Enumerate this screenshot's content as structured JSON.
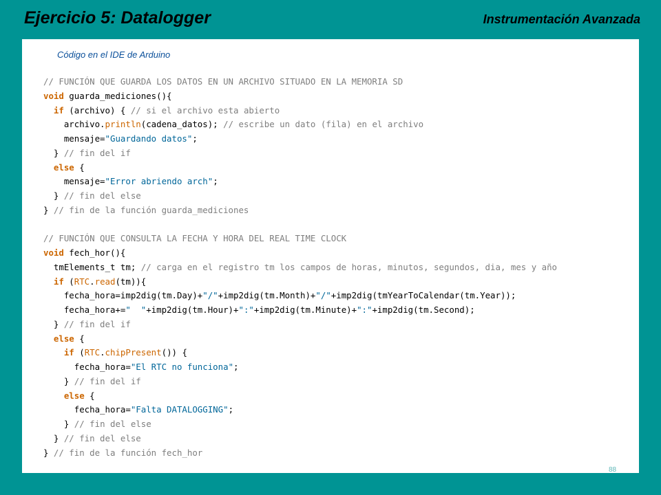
{
  "slide": {
    "title": "Ejercicio 5: Datalogger",
    "course": "Instrumentación Avanzada",
    "caption": "Código  en el IDE de Arduino",
    "page_number": "88"
  },
  "colors": {
    "background": "#009494",
    "keyword": "#cc6600",
    "comment": "#7e7e7e",
    "string": "#006699",
    "caption": "#0a4f9a"
  },
  "code": {
    "lines": [
      [
        {
          "t": "// FUNCIÓN QUE GUARDA LOS DATOS EN UN ARCHIVO SITUADO EN LA MEMORIA SD",
          "c": "cm"
        }
      ],
      [
        {
          "t": "void",
          "c": "tp"
        },
        {
          "t": " guarda_mediciones(){",
          "c": "id"
        }
      ],
      [
        {
          "t": "  ",
          "c": "id"
        },
        {
          "t": "if",
          "c": "kw"
        },
        {
          "t": " (archivo) { ",
          "c": "id"
        },
        {
          "t": "// si el archivo esta abierto",
          "c": "cm"
        }
      ],
      [
        {
          "t": "    archivo.",
          "c": "id"
        },
        {
          "t": "println",
          "c": "fn"
        },
        {
          "t": "(cadena_datos); ",
          "c": "id"
        },
        {
          "t": "// escribe un dato (fila) en el archivo",
          "c": "cm"
        }
      ],
      [
        {
          "t": "    mensaje=",
          "c": "id"
        },
        {
          "t": "\"Guardando datos\"",
          "c": "st"
        },
        {
          "t": ";",
          "c": "id"
        }
      ],
      [
        {
          "t": "  } ",
          "c": "id"
        },
        {
          "t": "// fin del if",
          "c": "cm"
        }
      ],
      [
        {
          "t": "  ",
          "c": "id"
        },
        {
          "t": "else",
          "c": "kw"
        },
        {
          "t": " {",
          "c": "id"
        }
      ],
      [
        {
          "t": "    mensaje=",
          "c": "id"
        },
        {
          "t": "\"Error abriendo arch\"",
          "c": "st"
        },
        {
          "t": ";",
          "c": "id"
        }
      ],
      [
        {
          "t": "  } ",
          "c": "id"
        },
        {
          "t": "// fin del else",
          "c": "cm"
        }
      ],
      [
        {
          "t": "} ",
          "c": "id"
        },
        {
          "t": "// fin de la función guarda_mediciones",
          "c": "cm"
        }
      ],
      [],
      [
        {
          "t": "// FUNCIÓN QUE CONSULTA LA FECHA Y HORA DEL REAL TIME CLOCK",
          "c": "cm"
        }
      ],
      [
        {
          "t": "void",
          "c": "tp"
        },
        {
          "t": " fech_hor(){",
          "c": "id"
        }
      ],
      [
        {
          "t": "  tmElements_t tm; ",
          "c": "id"
        },
        {
          "t": "// carga en el registro tm los campos de horas, minutos, segundos, dia, mes y año",
          "c": "cm"
        }
      ],
      [
        {
          "t": "  ",
          "c": "id"
        },
        {
          "t": "if",
          "c": "kw"
        },
        {
          "t": " (",
          "c": "id"
        },
        {
          "t": "RTC",
          "c": "fn"
        },
        {
          "t": ".",
          "c": "id"
        },
        {
          "t": "read",
          "c": "fn"
        },
        {
          "t": "(tm)){",
          "c": "id"
        }
      ],
      [
        {
          "t": "    fecha_hora=imp2dig(tm.Day)+",
          "c": "id"
        },
        {
          "t": "\"/\"",
          "c": "st"
        },
        {
          "t": "+imp2dig(tm.Month)+",
          "c": "id"
        },
        {
          "t": "\"/\"",
          "c": "st"
        },
        {
          "t": "+imp2dig(tmYearToCalendar(tm.Year));",
          "c": "id"
        }
      ],
      [
        {
          "t": "    fecha_hora+=",
          "c": "id"
        },
        {
          "t": "\"  \"",
          "c": "st"
        },
        {
          "t": "+imp2dig(tm.Hour)+",
          "c": "id"
        },
        {
          "t": "\":\"",
          "c": "st"
        },
        {
          "t": "+imp2dig(tm.Minute)+",
          "c": "id"
        },
        {
          "t": "\":\"",
          "c": "st"
        },
        {
          "t": "+imp2dig(tm.Second);",
          "c": "id"
        }
      ],
      [
        {
          "t": "  } ",
          "c": "id"
        },
        {
          "t": "// fin del if",
          "c": "cm"
        }
      ],
      [
        {
          "t": "  ",
          "c": "id"
        },
        {
          "t": "else",
          "c": "kw"
        },
        {
          "t": " {",
          "c": "id"
        }
      ],
      [
        {
          "t": "    ",
          "c": "id"
        },
        {
          "t": "if",
          "c": "kw"
        },
        {
          "t": " (",
          "c": "id"
        },
        {
          "t": "RTC",
          "c": "fn"
        },
        {
          "t": ".",
          "c": "id"
        },
        {
          "t": "chipPresent",
          "c": "fn"
        },
        {
          "t": "()) {",
          "c": "id"
        }
      ],
      [
        {
          "t": "      fecha_hora=",
          "c": "id"
        },
        {
          "t": "\"El RTC no funciona\"",
          "c": "st"
        },
        {
          "t": ";",
          "c": "id"
        }
      ],
      [
        {
          "t": "    } ",
          "c": "id"
        },
        {
          "t": "// fin del if",
          "c": "cm"
        }
      ],
      [
        {
          "t": "    ",
          "c": "id"
        },
        {
          "t": "else",
          "c": "kw"
        },
        {
          "t": " {",
          "c": "id"
        }
      ],
      [
        {
          "t": "      fecha_hora=",
          "c": "id"
        },
        {
          "t": "\"Falta DATALOGGING\"",
          "c": "st"
        },
        {
          "t": ";",
          "c": "id"
        }
      ],
      [
        {
          "t": "    } ",
          "c": "id"
        },
        {
          "t": "// fin del else",
          "c": "cm"
        }
      ],
      [
        {
          "t": "  } ",
          "c": "id"
        },
        {
          "t": "// fin del else",
          "c": "cm"
        }
      ],
      [
        {
          "t": "} ",
          "c": "id"
        },
        {
          "t": "// fin de la función fech_hor",
          "c": "cm"
        }
      ]
    ]
  }
}
